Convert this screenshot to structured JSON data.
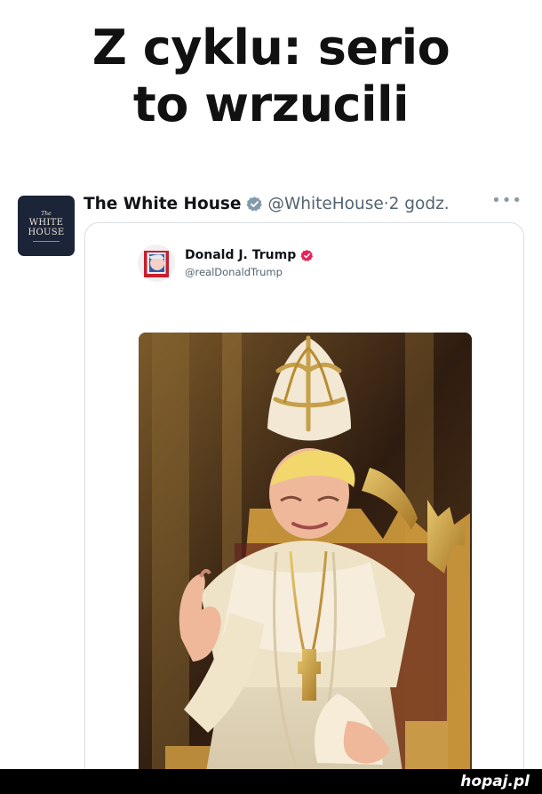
{
  "meme": {
    "title_line_1": "Z cyklu: serio",
    "title_line_2": "to wrzucili"
  },
  "post": {
    "account_name": "The White House",
    "handle": "@WhiteHouse",
    "separator": "·",
    "time": "2 godz.",
    "avatar_text": {
      "the": "The",
      "line_1": "WHITE",
      "line_2": "HOUSE"
    },
    "more_icon": "more-horizontal-icon",
    "verified_icon": "verified-badge-icon",
    "verified_color": "#829aab"
  },
  "quoted_post": {
    "author_name": "Donald J. Trump",
    "handle": "@realDonaldTrump",
    "verified_color": "#e0245e",
    "image_icon": "ai-image-of-trump-as-pope"
  },
  "footer": {
    "brand": "hopaj.pl"
  },
  "colors": {
    "background": "#ffffff",
    "text": "#0f1419",
    "muted": "#536471",
    "footer_bar": "#000000"
  }
}
